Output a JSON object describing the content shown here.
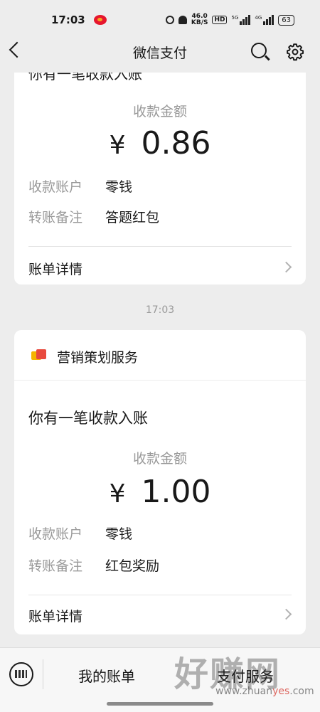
{
  "status_bar": {
    "time": "17:03",
    "net_speed_value": "46.0",
    "net_speed_unit": "KB/S",
    "hd": "HD",
    "signal1": "5G",
    "signal2": "4G",
    "battery": "63"
  },
  "nav": {
    "title": "微信支付",
    "back_icon": "back-arrow-icon",
    "search_icon": "search-icon",
    "settings_icon": "gear-icon"
  },
  "card1": {
    "cut_heading": "你有一笔收款入账",
    "amount_label": "收款金额",
    "currency": "¥",
    "amount": "0.86",
    "rows": [
      {
        "label": "收款账户",
        "value": "零钱"
      },
      {
        "label": "转账备注",
        "value": "答题红包"
      }
    ],
    "detail_link": "账单详情"
  },
  "time_separator": "17:03",
  "card2": {
    "service_name": "营销策划服务",
    "notice_title": "你有一笔收款入账",
    "amount_label": "收款金额",
    "currency": "¥",
    "amount": "1.00",
    "rows": [
      {
        "label": "收款账户",
        "value": "零钱"
      },
      {
        "label": "转账备注",
        "value": "红包奖励"
      }
    ],
    "detail_link": "账单详情"
  },
  "bottom_bar": {
    "keyboard_icon": "keyboard-icon",
    "menu_my_bill": "我的账单",
    "menu_service": "支付服务"
  },
  "watermark": {
    "main": "好赚网",
    "url_prefix": "www.zhuan",
    "url_highlight": "yes",
    "url_suffix": ".com"
  }
}
